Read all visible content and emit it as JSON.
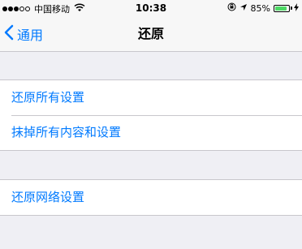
{
  "status_bar": {
    "carrier": "中国移动",
    "time": "10:38",
    "battery_percent": "85%",
    "battery_level": 0.85,
    "signal_bars_filled": 3,
    "signal_bars_total": 5
  },
  "nav": {
    "back_label": "通用",
    "title": "还原"
  },
  "groups": [
    {
      "items": [
        "还原所有设置",
        "抹掉所有内容和设置"
      ]
    },
    {
      "items": [
        "还原网络设置"
      ]
    }
  ],
  "colors": {
    "accent": "#007aff",
    "battery": "#4cd964",
    "background": "#efeff4"
  }
}
